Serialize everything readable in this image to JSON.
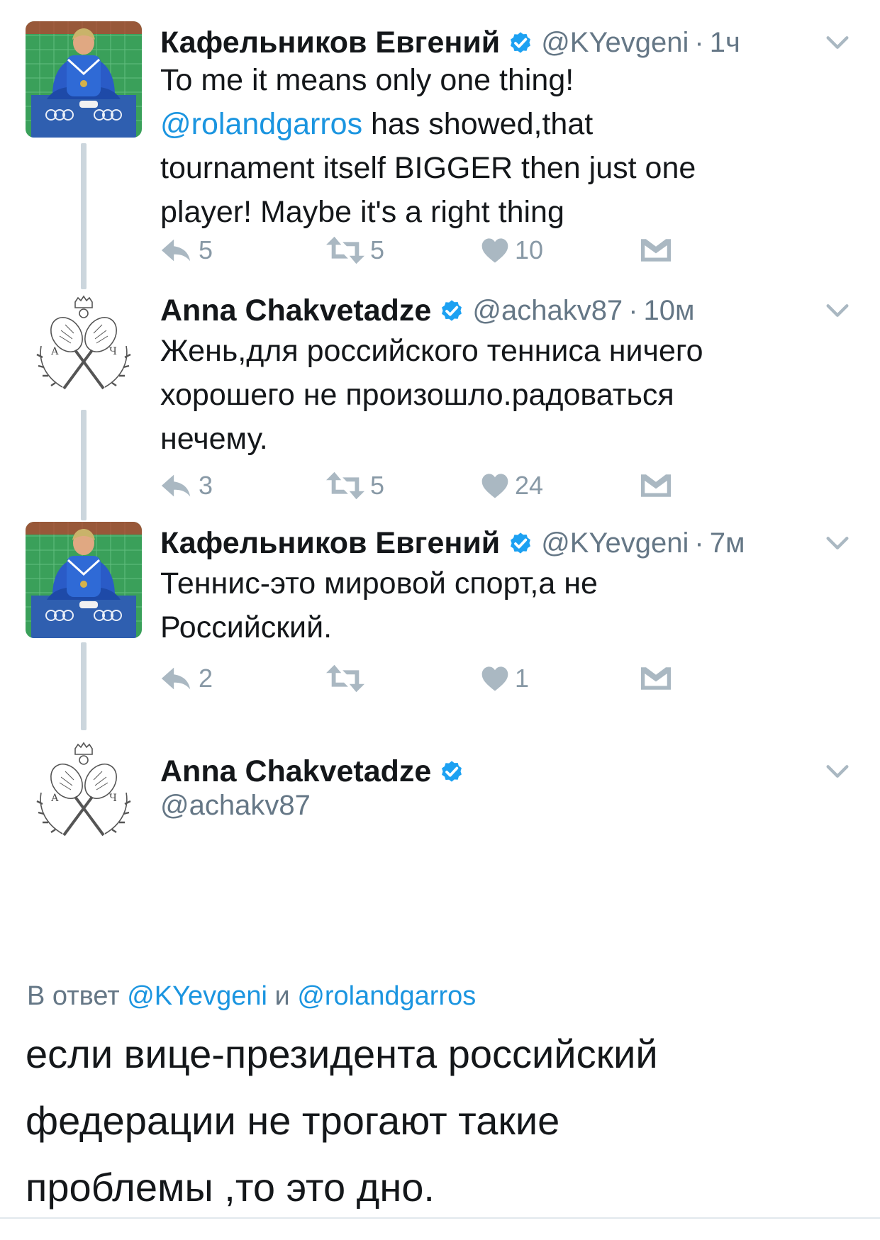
{
  "colors": {
    "text": "#14171a",
    "muted": "#657786",
    "link": "#1b95e0",
    "verified": "#1da1f2",
    "icon": "#aab8c2"
  },
  "tweets": [
    {
      "name": "Кафельников Евгений",
      "handle": "@KYevgeni",
      "dot": "·",
      "time": "1ч",
      "avatar": "tennis-player-photo",
      "lines": [
        [
          {
            "t": "To me it means only one thing!",
            "m": false
          }
        ],
        [
          {
            "t": "@rolandgarros",
            "m": true
          },
          {
            "t": " has showed,that",
            "m": false
          }
        ],
        [
          {
            "t": "tournament itself BIGGER then just one",
            "m": false
          }
        ],
        [
          {
            "t": "player! Maybe it's a right thing",
            "m": false
          }
        ]
      ],
      "replies": "5",
      "retweets": "5",
      "likes": "10"
    },
    {
      "name": "Anna Chakvetadze",
      "handle": "@achakv87",
      "dot": "·",
      "time": "10м",
      "avatar": "crossed-rackets-crest",
      "lines": [
        [
          {
            "t": "Жень,для российского тенниса ничего",
            "m": false
          }
        ],
        [
          {
            "t": "хорошего не произошло.радоваться",
            "m": false
          }
        ],
        [
          {
            "t": "нечему.",
            "m": false
          }
        ]
      ],
      "replies": "3",
      "retweets": "5",
      "likes": "24"
    },
    {
      "name": "Кафельников Евгений",
      "handle": "@KYevgeni",
      "dot": "·",
      "time": "7м",
      "avatar": "tennis-player-photo",
      "lines": [
        [
          {
            "t": "Теннис-это мировой спорт,а не",
            "m": false
          }
        ],
        [
          {
            "t": "Российский.",
            "m": false
          }
        ]
      ],
      "replies": "2",
      "retweets": "",
      "likes": "1"
    }
  ],
  "focused": {
    "name": "Anna Chakvetadze",
    "handle": "@achakv87",
    "avatar": "crossed-rackets-crest",
    "reply_prefix": "В ответ ",
    "reply_user1": "@KYevgeni",
    "reply_and": " и ",
    "reply_user2": "@rolandgarros",
    "text_lines": [
      "если вице-президента российский",
      "федерации не трогают такие",
      "проблемы ,то это дно."
    ]
  },
  "crest_letters": {
    "left": "А",
    "right": "Ч"
  }
}
